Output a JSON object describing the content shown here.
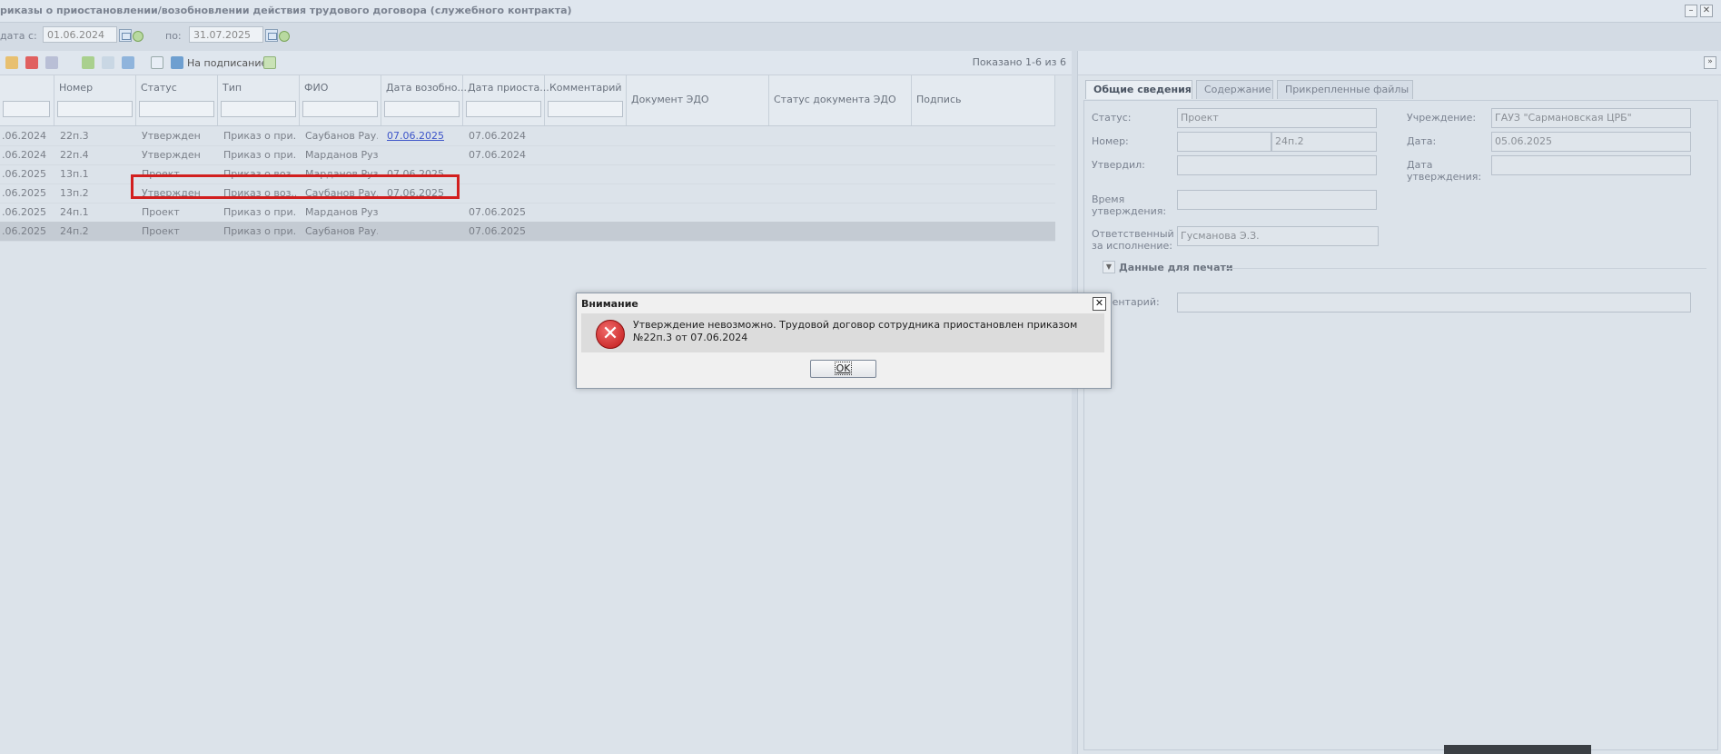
{
  "window": {
    "title": "риказы о приостановлении/возобновлении действия трудового договора (служебного контракта)",
    "minimize": "–",
    "close": "✕"
  },
  "filter": {
    "date_from_label": "дата с:",
    "date_from_value": "01.06.2024",
    "date_to_label": "по:",
    "date_to_value": "31.07.2025"
  },
  "toolbar": {
    "sign_label": "На подписание",
    "shown_text": "Показано 1-6 из 6"
  },
  "grid": {
    "columns": [
      "",
      "Номер",
      "Статус",
      "Тип",
      "ФИО",
      "Дата возобно...",
      "Дата приоста...",
      "Комментарий",
      "Документ ЭДО",
      "Статус документа ЭДО",
      "Подпись"
    ],
    "rows": [
      {
        "date": ".06.2024",
        "num": "22п.3",
        "status": "Утвержден",
        "type": "Приказ о при...",
        "fio": "Саубанов Рау...",
        "resume": "07.06.2025",
        "suspend": "07.06.2024"
      },
      {
        "date": ".06.2024",
        "num": "22п.4",
        "status": "Утвержден",
        "type": "Приказ о при...",
        "fio": "Марданов Руз...",
        "resume": "",
        "suspend": "07.06.2024"
      },
      {
        "date": ".06.2025",
        "num": "13п.1",
        "status": "Проект",
        "type": "Приказ о воз...",
        "fio": "Марданов Руз...",
        "resume": "07.06.2025",
        "suspend": ""
      },
      {
        "date": ".06.2025",
        "num": "13п.2",
        "status": "Утвержден",
        "type": "Приказ о воз...",
        "fio": "Саубанов Рау...",
        "resume": "07.06.2025",
        "suspend": ""
      },
      {
        "date": ".06.2025",
        "num": "24п.1",
        "status": "Проект",
        "type": "Приказ о при...",
        "fio": "Марданов Руз...",
        "resume": "",
        "suspend": "07.06.2025"
      },
      {
        "date": ".06.2025",
        "num": "24п.2",
        "status": "Проект",
        "type": "Приказ о при...",
        "fio": "Саубанов Рау...",
        "resume": "",
        "suspend": "07.06.2025"
      }
    ]
  },
  "details": {
    "tabs": [
      "Общие сведения",
      "Содержание",
      "Прикрепленные файлы"
    ],
    "status_label": "Статус:",
    "status_value": "Проект",
    "institution_label": "Учреждение:",
    "institution_value": "ГАУЗ \"Сармановская ЦРБ\"",
    "number_label": "Номер:",
    "number_value": "24п.2",
    "date_label": "Дата:",
    "date_value": "05.06.2025",
    "approved_label": "Утвердил:",
    "approval_date_label": "Дата утверждения:",
    "approval_time_label": "Время утверждения:",
    "responsible_label": "Ответственный за исполнение:",
    "responsible_value": "Гусманова Э.З.",
    "print_section": "Данные для печати",
    "comment_label": "мментарий:"
  },
  "dialog": {
    "title": "Внимание",
    "message": "Утверждение невозможно. Трудовой договор сотрудника приостановлен приказом №22п.3 от 07.06.2024",
    "ok": "OK",
    "close": "✕",
    "icon": "error-icon"
  }
}
